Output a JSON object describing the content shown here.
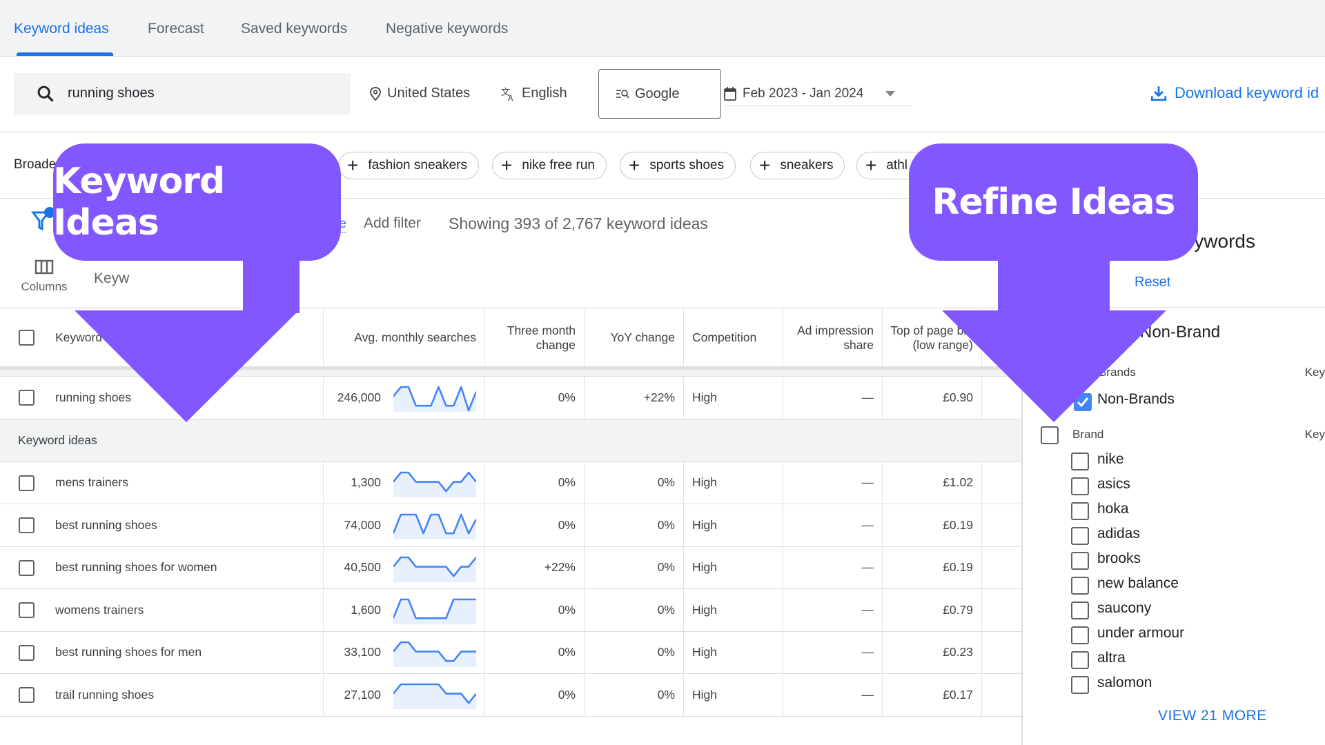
{
  "tabs": [
    {
      "label": "Keyword ideas",
      "active": true
    },
    {
      "label": "Forecast",
      "active": false
    },
    {
      "label": "Saved keywords",
      "active": false
    },
    {
      "label": "Negative keywords",
      "active": false
    }
  ],
  "search": {
    "value": "running shoes",
    "location": "United States",
    "language": "English",
    "network": "Google",
    "date_range": "Feb 2023 - Jan 2024",
    "download_label": "Download keyword id"
  },
  "broaden": {
    "label": "Broaden",
    "chips": [
      "fashion sneakers",
      "nike free run",
      "sports shoes",
      "sneakers",
      "athl"
    ]
  },
  "filters": {
    "expand_label": "re",
    "add_filter": "Add filter",
    "showing": "Showing 393 of 2,767 keyword ideas",
    "columns_label": "Columns",
    "group_label": "Keyw"
  },
  "table": {
    "headers": {
      "keyword": "Keyword",
      "avg_monthly": "Avg. monthly searches",
      "three_month": "Three month change",
      "yoy": "YoY change",
      "competition": "Competition",
      "ad_impression": "Ad impression share",
      "top_bid_low": "Top of page bid (low range)"
    },
    "provided": [
      {
        "keyword": "running shoes",
        "searches": "246,000",
        "trend": [
          3,
          5,
          5,
          1,
          1,
          1,
          5,
          1,
          1,
          5,
          0,
          4
        ],
        "three_month": "0%",
        "yoy": "+22%",
        "competition": "High",
        "ad_share": "—",
        "bid_low": "£0.90"
      }
    ],
    "section_label": "Keyword ideas",
    "ideas": [
      {
        "keyword": "mens trainers",
        "searches": "1,300",
        "trend": [
          3,
          5,
          5,
          3,
          3,
          3,
          3,
          1,
          3,
          3,
          5,
          3
        ],
        "three_month": "0%",
        "yoy": "0%",
        "competition": "High",
        "ad_share": "—",
        "bid_low": "£1.02"
      },
      {
        "keyword": "best running shoes",
        "searches": "74,000",
        "trend": [
          1,
          5,
          5,
          5,
          1,
          5,
          5,
          1,
          1,
          5,
          1,
          4
        ],
        "three_month": "0%",
        "yoy": "0%",
        "competition": "High",
        "ad_share": "—",
        "bid_low": "£0.19"
      },
      {
        "keyword": "best running shoes for women",
        "searches": "40,500",
        "trend": [
          3,
          5,
          5,
          3,
          3,
          3,
          3,
          3,
          1,
          3,
          3,
          5
        ],
        "three_month": "+22%",
        "yoy": "0%",
        "competition": "High",
        "ad_share": "—",
        "bid_low": "£0.19"
      },
      {
        "keyword": "womens trainers",
        "searches": "1,600",
        "trend": [
          1,
          5,
          5,
          1,
          1,
          1,
          1,
          1,
          5,
          5,
          5,
          5
        ],
        "three_month": "0%",
        "yoy": "0%",
        "competition": "High",
        "ad_share": "—",
        "bid_low": "£0.79"
      },
      {
        "keyword": "best running shoes for men",
        "searches": "33,100",
        "trend": [
          3,
          5,
          5,
          3,
          3,
          3,
          3,
          1,
          1,
          3,
          3,
          3
        ],
        "three_month": "0%",
        "yoy": "0%",
        "competition": "High",
        "ad_share": "—",
        "bid_low": "£0.23"
      },
      {
        "keyword": "trail running shoes",
        "searches": "27,100",
        "trend": [
          3,
          5,
          5,
          5,
          5,
          5,
          5,
          3,
          3,
          3,
          1,
          3
        ],
        "three_month": "0%",
        "yoy": "0%",
        "competition": "High",
        "ad_share": "—",
        "bid_low": "£0.17"
      }
    ]
  },
  "refine": {
    "title": "Refine keywords",
    "reset_label": "Reset",
    "group_title": "Non-Brand",
    "sub_header_1": "Brands",
    "key_col": "Key",
    "non_brands_label": "Non-Brands",
    "non_brands_checked": true,
    "brand_header": "Brand",
    "brands": [
      "nike",
      "asics",
      "hoka",
      "adidas",
      "brooks",
      "new balance",
      "saucony",
      "under armour",
      "altra",
      "salomon"
    ],
    "view_more": "VIEW 21 MORE"
  },
  "callouts": {
    "left": "Keyword Ideas",
    "right": "Refine Ideas"
  },
  "colors": {
    "accent": "#1a73e8",
    "callout": "#8257ff",
    "sparkline": "#4285f4"
  }
}
